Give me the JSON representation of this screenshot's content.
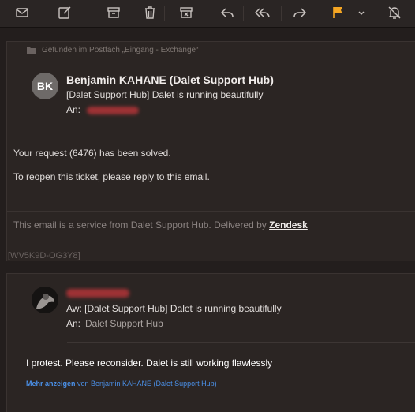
{
  "toolbar": {
    "buttons": [
      {
        "name": "compose-new-icon"
      },
      {
        "name": "edit-draft-icon"
      },
      {
        "name": "archive-icon"
      },
      {
        "name": "trash-icon"
      },
      {
        "name": "junk-icon"
      },
      {
        "name": "reply-icon"
      },
      {
        "name": "reply-all-icon"
      },
      {
        "name": "forward-icon"
      },
      {
        "name": "flag-icon"
      },
      {
        "name": "mute-icon"
      }
    ],
    "flag_color": "#f5a623"
  },
  "message1": {
    "found_in": "Gefunden im Postfach „Eingang - Exchange“",
    "avatar_initials": "BK",
    "sender": "Benjamin KAHANE (Dalet Support Hub)",
    "subject": "[Dalet Support Hub] Dalet is running beautifully",
    "to_label": "An:",
    "body_lines": [
      "Your request (6476) has been solved.",
      "To reopen this ticket, please reply to this email."
    ],
    "footer_text": "This email is a service from Dalet Support Hub. Delivered by ",
    "footer_link": "Zendesk",
    "ticket_id": "[WV5K9D-OG3Y8]"
  },
  "message2": {
    "subject": "Aw: [Dalet Support Hub] Dalet is running beautifully",
    "to_label": "An:",
    "to_value": "Dalet Support Hub",
    "body": "I protest. Please reconsider. Dalet is still working flawlessly",
    "more_label": "Mehr anzeigen",
    "more_suffix": " von Benjamin KAHANE (Dalet Support Hub)"
  },
  "colors": {
    "background": "#231e1d",
    "message_bg": "#2b2523",
    "link_blue": "#4a8fe6",
    "redaction": "#b23438"
  }
}
